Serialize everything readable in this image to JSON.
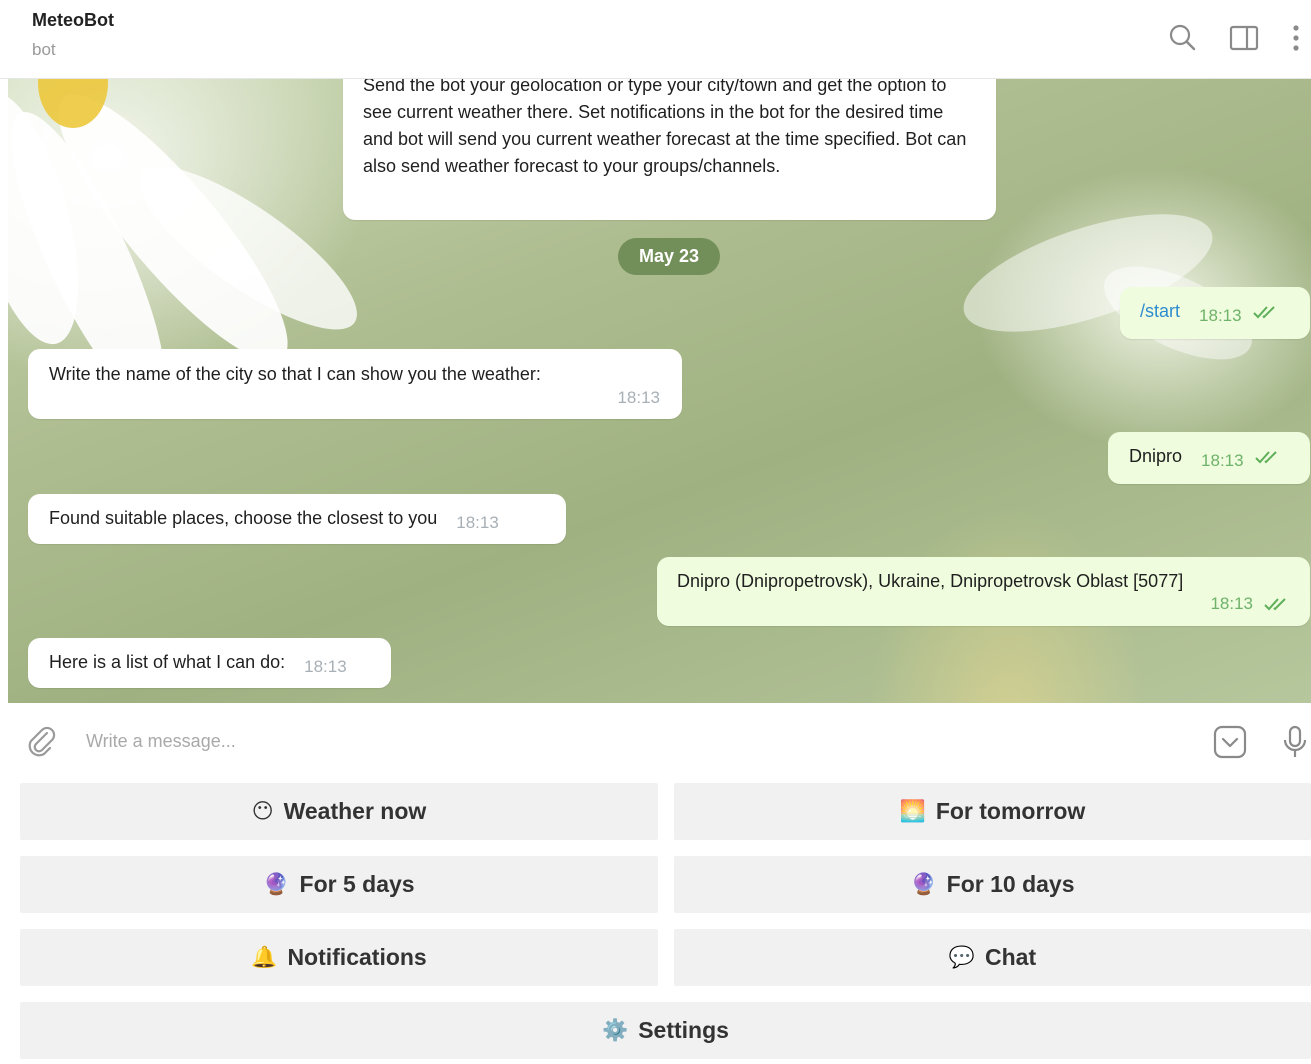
{
  "header": {
    "title": "MeteoBot",
    "subtitle": "bot"
  },
  "messages": {
    "intro": "Send the bot your geolocation or type your city/town and get the option to see current weather there. Set notifications in the bot for the desired time and bot will send you current weather forecast at the time specified. Bot can also send weather forecast to your groups/channels.",
    "date": "May 23",
    "start": {
      "text": "/start",
      "time": "18:13"
    },
    "ask_city": {
      "text": "Write the name of the city so that I can show you the weather:",
      "time": "18:13"
    },
    "city": {
      "text": "Dnipro",
      "time": "18:13"
    },
    "found": {
      "text": "Found suitable places, choose the closest to you",
      "time": "18:13"
    },
    "place": {
      "text": "Dnipro (Dnipropetrovsk), Ukraine, Dnipropetrovsk Oblast [5077]",
      "time": "18:13"
    },
    "list": {
      "text": "Here is a list of what I can do:",
      "time": "18:13"
    }
  },
  "composer": {
    "placeholder": "Write a message..."
  },
  "keyboard": {
    "weather_now": {
      "emoji": "😶",
      "label": "Weather now"
    },
    "tomorrow": {
      "emoji": "🌅",
      "label": "For tomorrow"
    },
    "five_days": {
      "emoji": "🔮",
      "label": "For 5 days"
    },
    "ten_days": {
      "emoji": "🔮",
      "label": "For 10 days"
    },
    "notifications": {
      "emoji": "🔔",
      "label": "Notifications"
    },
    "chat": {
      "emoji": "💬",
      "label": "Chat"
    },
    "settings": {
      "emoji": "⚙️",
      "label": "Settings"
    }
  },
  "icons": [
    "search-icon",
    "sidebar-toggle-icon",
    "more-icon",
    "attach-icon",
    "emoji-sticker-icon",
    "microphone-icon",
    "double-check-icon"
  ],
  "colors": {
    "outgoing_bubble": "#effdde",
    "time_outgoing": "#6fb26a",
    "link": "#2f8bd0",
    "date_pill": "#678650"
  }
}
